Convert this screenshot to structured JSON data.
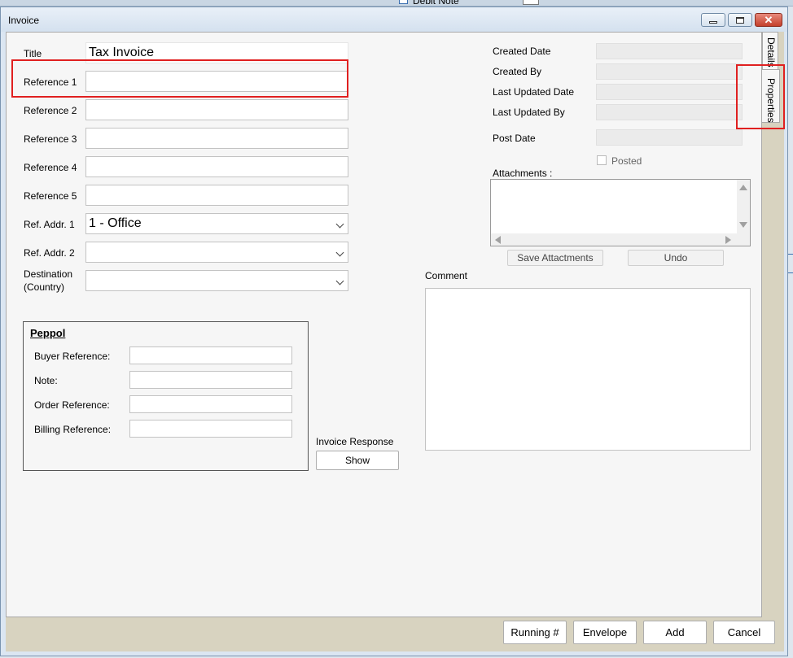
{
  "background_app": {
    "checkbox_label": "Debit Note"
  },
  "window": {
    "title": "Invoice"
  },
  "left_form": {
    "title": {
      "label": "Title",
      "value": "Tax Invoice"
    },
    "reference1": {
      "label": "Reference 1",
      "value": ""
    },
    "reference2": {
      "label": "Reference 2",
      "value": ""
    },
    "reference3": {
      "label": "Reference 3",
      "value": ""
    },
    "reference4": {
      "label": "Reference 4",
      "value": ""
    },
    "reference5": {
      "label": "Reference 5",
      "value": ""
    },
    "ref_addr1": {
      "label": "Ref. Addr. 1",
      "value": "1 - Office"
    },
    "ref_addr2": {
      "label": "Ref. Addr. 2",
      "value": ""
    },
    "destination": {
      "label_line1": "Destination",
      "label_line2": "(Country)",
      "value": ""
    }
  },
  "peppol": {
    "heading": "Peppol",
    "buyer_reference": {
      "label": "Buyer Reference:",
      "value": ""
    },
    "note": {
      "label": "Note:",
      "value": ""
    },
    "order_reference": {
      "label": "Order Reference:",
      "value": ""
    },
    "billing_reference": {
      "label": "Billing Reference:",
      "value": ""
    }
  },
  "invoice_response": {
    "label": "Invoice Response",
    "button": "Show"
  },
  "meta": {
    "created_date": {
      "label": "Created Date",
      "value": ""
    },
    "created_by": {
      "label": "Created By",
      "value": ""
    },
    "last_updated_date": {
      "label": "Last Updated Date",
      "value": ""
    },
    "last_updated_by": {
      "label": "Last Updated By",
      "value": ""
    },
    "post_date": {
      "label": "Post Date",
      "value": ""
    },
    "posted": {
      "label": "Posted",
      "checked": false
    }
  },
  "attachments": {
    "label": "Attachments :",
    "save_button": "Save Attactments",
    "undo_button": "Undo"
  },
  "comment": {
    "label": "Comment",
    "value": ""
  },
  "side_tabs": {
    "details": "Details",
    "properties": "Properties"
  },
  "footer": {
    "running": "Running #",
    "envelope": "Envelope",
    "add": "Add",
    "cancel": "Cancel"
  },
  "colors": {
    "highlight": "#e02020",
    "panel_bg": "#f6f6f6",
    "footer_bg": "#d8d3c0"
  }
}
